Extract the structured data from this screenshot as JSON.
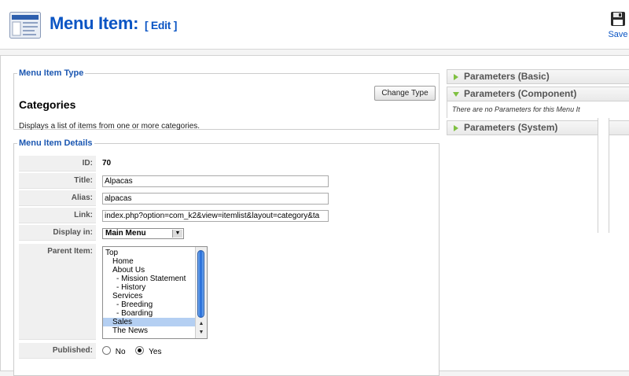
{
  "header": {
    "title": "Menu Item:",
    "edit_tag": "[ Edit ]",
    "save_label": "Save"
  },
  "type_section": {
    "legend": "Menu Item Type",
    "type_name": "Categories",
    "description": "Displays a list of items from one or more categories.",
    "change_type_label": "Change Type"
  },
  "details": {
    "legend": "Menu Item Details",
    "id_label": "ID:",
    "id_value": "70",
    "title_label": "Title:",
    "title_value": "Alpacas",
    "alias_label": "Alias:",
    "alias_value": "alpacas",
    "link_label": "Link:",
    "link_value": "index.php?option=com_k2&view=itemlist&layout=category&ta",
    "display_in_label": "Display in:",
    "display_in_value": "Main Menu",
    "parent_label": "Parent Item:",
    "parent_items": [
      "Top",
      "Home",
      "About Us",
      "- Mission Statement",
      "- History",
      "Services",
      "- Breeding",
      "- Boarding",
      "Sales",
      "The News"
    ],
    "parent_selected": "Sales",
    "published_label": "Published:",
    "published_no": "No",
    "published_yes": "Yes",
    "published_value": "Yes"
  },
  "parameters": {
    "basic_label": "Parameters (Basic)",
    "component_label": "Parameters (Component)",
    "component_note": "There are no Parameters for this Menu It",
    "system_label": "Parameters (System)"
  },
  "colors": {
    "title_blue": "#0b55c4",
    "legend_blue": "#1b57b1",
    "toggle_green": "#7fc041",
    "selected_row": "#b4cff2"
  }
}
